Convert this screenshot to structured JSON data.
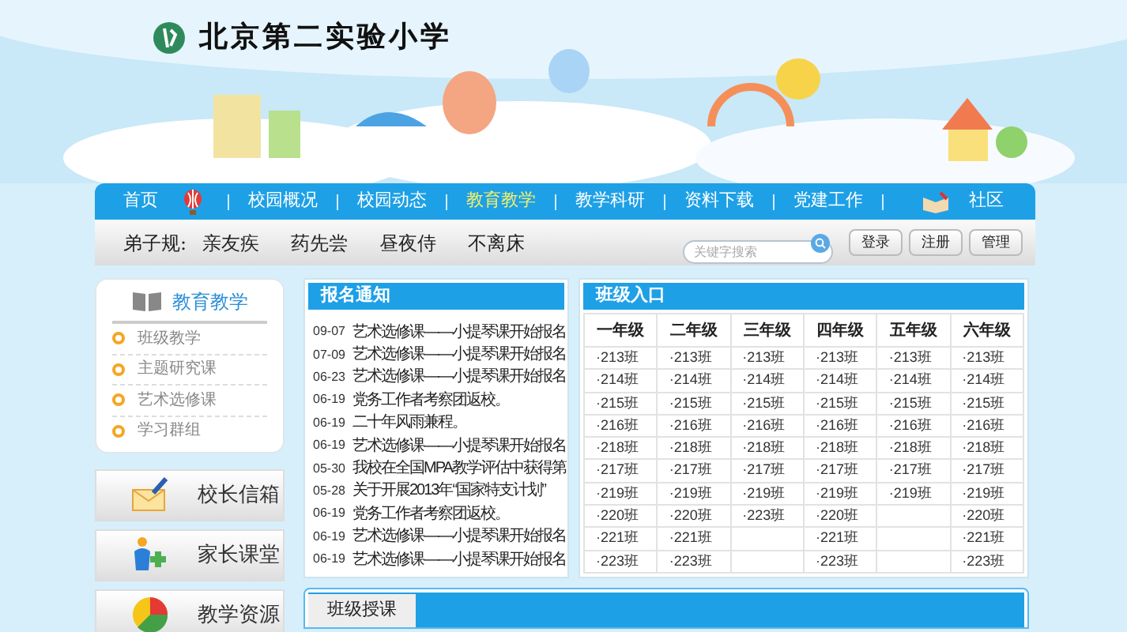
{
  "header": {
    "school_name": "北京第二实验小学"
  },
  "nav": [
    {
      "label": "首页",
      "selected": false
    },
    {
      "label": "校园概况",
      "selected": false
    },
    {
      "label": "校园动态",
      "selected": false
    },
    {
      "label": "教育教学",
      "selected": true
    },
    {
      "label": "教学科研",
      "selected": false
    },
    {
      "label": "资料下载",
      "selected": false
    },
    {
      "label": "党建工作",
      "selected": false
    },
    {
      "label": "社区",
      "selected": false
    }
  ],
  "motto": {
    "label": "弟子规:",
    "phrases": [
      "亲友疾",
      "药先尝",
      "昼夜侍",
      "不离床"
    ]
  },
  "search": {
    "placeholder": "关键字搜索"
  },
  "account_buttons": [
    "登录",
    "注册",
    "管理"
  ],
  "sidebar": {
    "title": "教育教学",
    "items": [
      "班级教学",
      "主题研究课",
      "艺术选修课",
      "学习群组"
    ]
  },
  "quick_links": [
    "校长信箱",
    "家长课堂",
    "教学资源"
  ],
  "notices": {
    "title": "报名通知",
    "items": [
      {
        "date": "09-07",
        "title": "艺术选修课——小提琴课开始报名"
      },
      {
        "date": "07-09",
        "title": "艺术选修课——小提琴课开始报名"
      },
      {
        "date": "06-23",
        "title": "艺术选修课——小提琴课开始报名"
      },
      {
        "date": "06-19",
        "title": "党务工作者考察团返校。"
      },
      {
        "date": "06-19",
        "title": "二十年风雨兼程。"
      },
      {
        "date": "06-19",
        "title": "艺术选修课——小提琴课开始报名"
      },
      {
        "date": "05-30",
        "title": "我校在全国MPA教学评估中获得第"
      },
      {
        "date": "05-28",
        "title": "关于开展2013年“国家特支计划”"
      },
      {
        "date": "06-19",
        "title": "党务工作者考察团返校。"
      },
      {
        "date": "06-19",
        "title": "艺术选修课——小提琴课开始报名"
      },
      {
        "date": "06-19",
        "title": "艺术选修课——小提琴课开始报名"
      }
    ]
  },
  "class_entry": {
    "title": "班级入口",
    "grades": [
      {
        "name": "一年级",
        "classes": [
          "·213班",
          "·214班",
          "·215班",
          "·216班",
          "·218班",
          "·217班",
          "·219班",
          "·220班",
          "·221班",
          "·223班"
        ]
      },
      {
        "name": "二年级",
        "classes": [
          "·213班",
          "·214班",
          "·215班",
          "·216班",
          "·218班",
          "·217班",
          "·219班",
          "·220班",
          "·221班",
          "·223班"
        ]
      },
      {
        "name": "三年级",
        "classes": [
          "·213班",
          "·214班",
          "·215班",
          "·216班",
          "·218班",
          "·217班",
          "·219班",
          "·223班"
        ]
      },
      {
        "name": "四年级",
        "classes": [
          "·213班",
          "·214班",
          "·215班",
          "·216班",
          "·218班",
          "·217班",
          "·219班",
          "·220班",
          "·221班",
          "·223班"
        ]
      },
      {
        "name": "五年级",
        "classes": [
          "·213班",
          "·214班",
          "·215班",
          "·216班",
          "·218班",
          "·217班",
          "·219班"
        ]
      },
      {
        "name": "六年级",
        "classes": [
          "·213班",
          "·214班",
          "·215班",
          "·216班",
          "·218班",
          "·217班",
          "·219班",
          "·220班",
          "·221班",
          "·223班"
        ]
      }
    ]
  },
  "lessons": {
    "tab": "班级授课"
  }
}
